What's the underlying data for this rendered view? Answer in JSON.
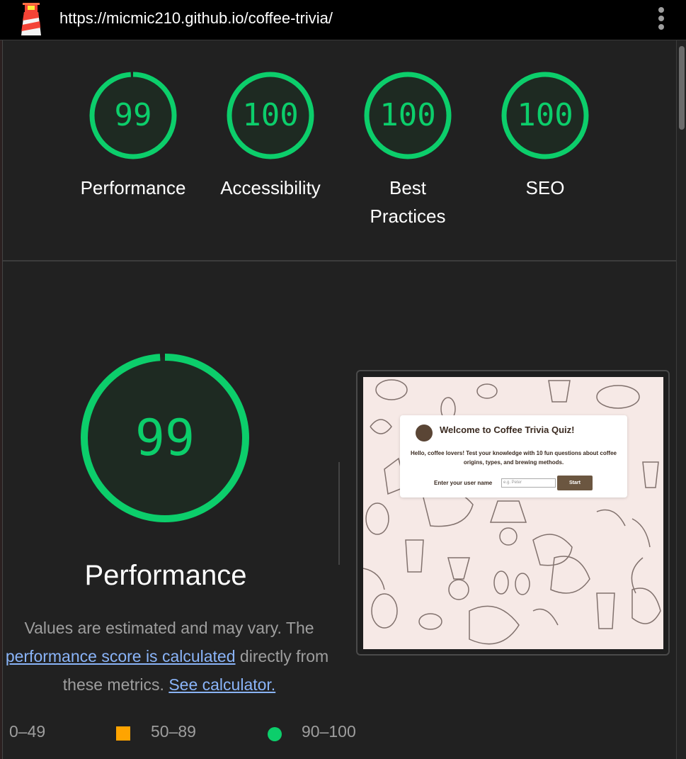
{
  "topbar": {
    "url": "https://micmic210.github.io/coffee-trivia/",
    "logo_icon": "lighthouse-icon",
    "menu_icon": "kebab-menu-icon"
  },
  "gauges": [
    {
      "label": "Performance",
      "score": "99",
      "percent": 99
    },
    {
      "label": "Accessibility",
      "score": "100",
      "percent": 100
    },
    {
      "label": "Best Practices",
      "score": "100",
      "percent": 100
    },
    {
      "label": "SEO",
      "score": "100",
      "percent": 100
    }
  ],
  "performance": {
    "score": "99",
    "percent": 99,
    "title": "Performance",
    "desc_prefix": "Values are estimated and may vary. The",
    "desc_link": "performance score is calculated",
    "desc_middle": "directly from these metrics.",
    "desc_calc_link": "See calculator."
  },
  "legend": {
    "fail": "0–49",
    "average": "50–89",
    "pass": "90–100"
  },
  "screenshot": {
    "title": "Welcome to Coffee Trivia Quiz!",
    "text": "Hello, coffee lovers! Test your knowledge with 10 fun questions about coffee origins, types, and brewing methods.",
    "username_label": "Enter your user name",
    "username_placeholder": "e.g. Peter",
    "start_label": "Start"
  },
  "colors": {
    "pass": "#0cce6b",
    "average": "#ffa400",
    "link": "#8ab4f8",
    "background": "#212121"
  }
}
